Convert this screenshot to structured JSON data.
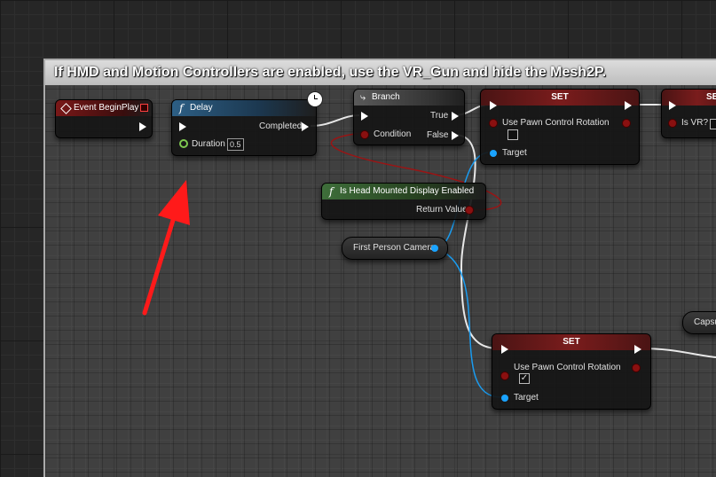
{
  "comment": {
    "title": "If HMD and Motion Controllers are enabled, use the VR_Gun and hide the Mesh2P."
  },
  "nodes": {
    "event_begin_play": {
      "title": "Event BeginPlay"
    },
    "delay": {
      "icon": "function-icon",
      "title": "Delay",
      "completed": "Completed",
      "duration_label": "Duration",
      "duration_value": "0.5"
    },
    "branch": {
      "icon": "branch-icon",
      "title": "Branch",
      "condition": "Condition",
      "true_label": "True",
      "false_label": "False"
    },
    "set_top": {
      "title": "SET",
      "property": "Use Pawn Control Rotation",
      "target": "Target",
      "checked": false
    },
    "set_right": {
      "title": "SE",
      "property": "Is VR?"
    },
    "is_hmd": {
      "icon": "function-icon",
      "title": "Is Head Mounted Display Enabled",
      "return_value": "Return Value"
    },
    "camera": {
      "label": "First Person Camera"
    },
    "set_bottom": {
      "title": "SET",
      "property": "Use Pawn Control Rotation",
      "target": "Target",
      "checked": true,
      "check_glyph": "✓"
    },
    "capsule": {
      "label": "Capsu"
    }
  },
  "colors": {
    "exec": "#ffffff",
    "bool": "#8a1010",
    "object": "#1aa3ff",
    "float": "#7ec850",
    "arrow": "#ff1a1a"
  }
}
